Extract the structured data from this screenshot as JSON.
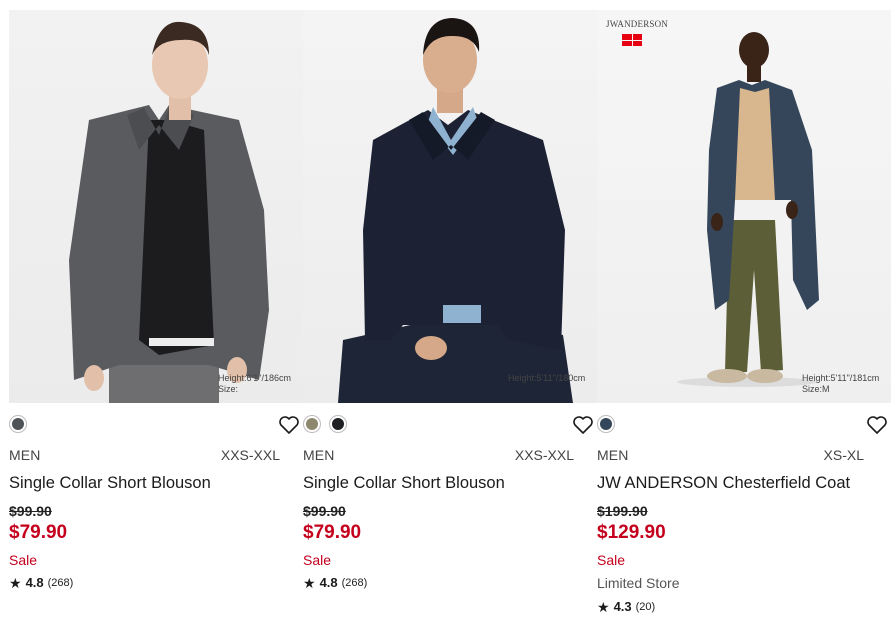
{
  "products": [
    {
      "image_alt": "Single Collar Short Blouson",
      "height_line1": "Height:6'1\"/186cm",
      "height_line2": "Size:",
      "swatches": [
        "#4e5358"
      ],
      "gender": "MEN",
      "sizes": "XXS-XXL",
      "name": "Single Collar Short Blouson",
      "original_price": "$99.90",
      "sale_price": "$79.90",
      "sale_label": "Sale",
      "rating": "4.8",
      "review_count": "(268)"
    },
    {
      "image_alt": "Single Collar Short Blouson",
      "height_line1": "Height:5'11\"/180cm",
      "height_line2": "",
      "swatches": [
        "#8c876d",
        "#1f2024"
      ],
      "gender": "MEN",
      "sizes": "XXS-XXL",
      "name": "Single Collar Short Blouson",
      "original_price": "$99.90",
      "sale_price": "$79.90",
      "sale_label": "Sale",
      "rating": "4.8",
      "review_count": "(268)"
    },
    {
      "image_alt": "JW ANDERSON Chesterfield Coat",
      "brand_logo": "JWANDERSON",
      "height_line1": "Height:5'11\"/181cm",
      "height_line2": "Size:M",
      "swatches": [
        "#34465a"
      ],
      "gender": "MEN",
      "sizes": "XS-XL",
      "name": "JW ANDERSON Chesterfield Coat",
      "original_price": "$199.90",
      "sale_price": "$129.90",
      "sale_label": "Sale",
      "store_label": "Limited Store",
      "rating": "4.3",
      "review_count": "(20)"
    }
  ],
  "colors": {
    "sale_red": "#c4001d",
    "text": "#1b1b1b"
  },
  "icons": {
    "favorite": "heart-outline-icon",
    "rating": "star-icon"
  }
}
